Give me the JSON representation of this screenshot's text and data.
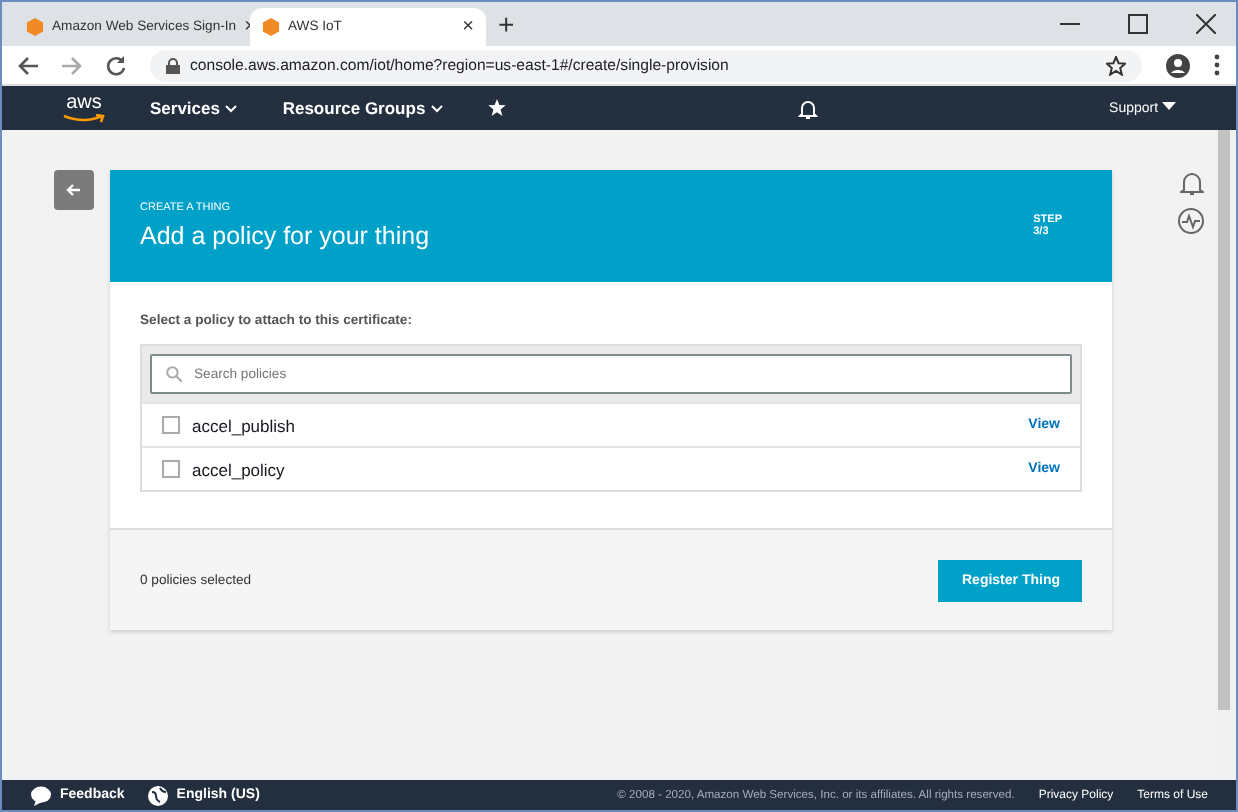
{
  "browser": {
    "tabs": [
      {
        "title": "Amazon Web Services Sign-In",
        "selected": false,
        "close": "×"
      },
      {
        "title": "AWS IoT",
        "selected": true,
        "close": "×"
      }
    ],
    "new_tab": "+",
    "url": "console.aws.amazon.com/iot/home?region=us-east-1#/create/single-provision"
  },
  "nav": {
    "logo": "aws",
    "items": [
      "Services",
      "Resource Groups"
    ],
    "support": "Support"
  },
  "card": {
    "eyebrow": "CREATE A THING",
    "title": "Add a policy for your thing",
    "step": "STEP",
    "step_count": "3/3",
    "prompt": "Select a policy to attach to this certificate:",
    "search": {
      "placeholder": "Search policies"
    },
    "policies": [
      {
        "name": "accel_publish",
        "checked": false,
        "link": "View"
      },
      {
        "name": "accel_policy",
        "checked": false,
        "link": "View"
      }
    ],
    "selected_count": "0 policies selected",
    "button": "Register Thing"
  },
  "footer": {
    "feedback": "Feedback",
    "language": "English (US)",
    "copyright": "© 2008 - 2020, Amazon Web Services, Inc. or its affiliates. All rights reserved.",
    "links": [
      "Privacy Policy",
      "Terms of Use"
    ]
  }
}
